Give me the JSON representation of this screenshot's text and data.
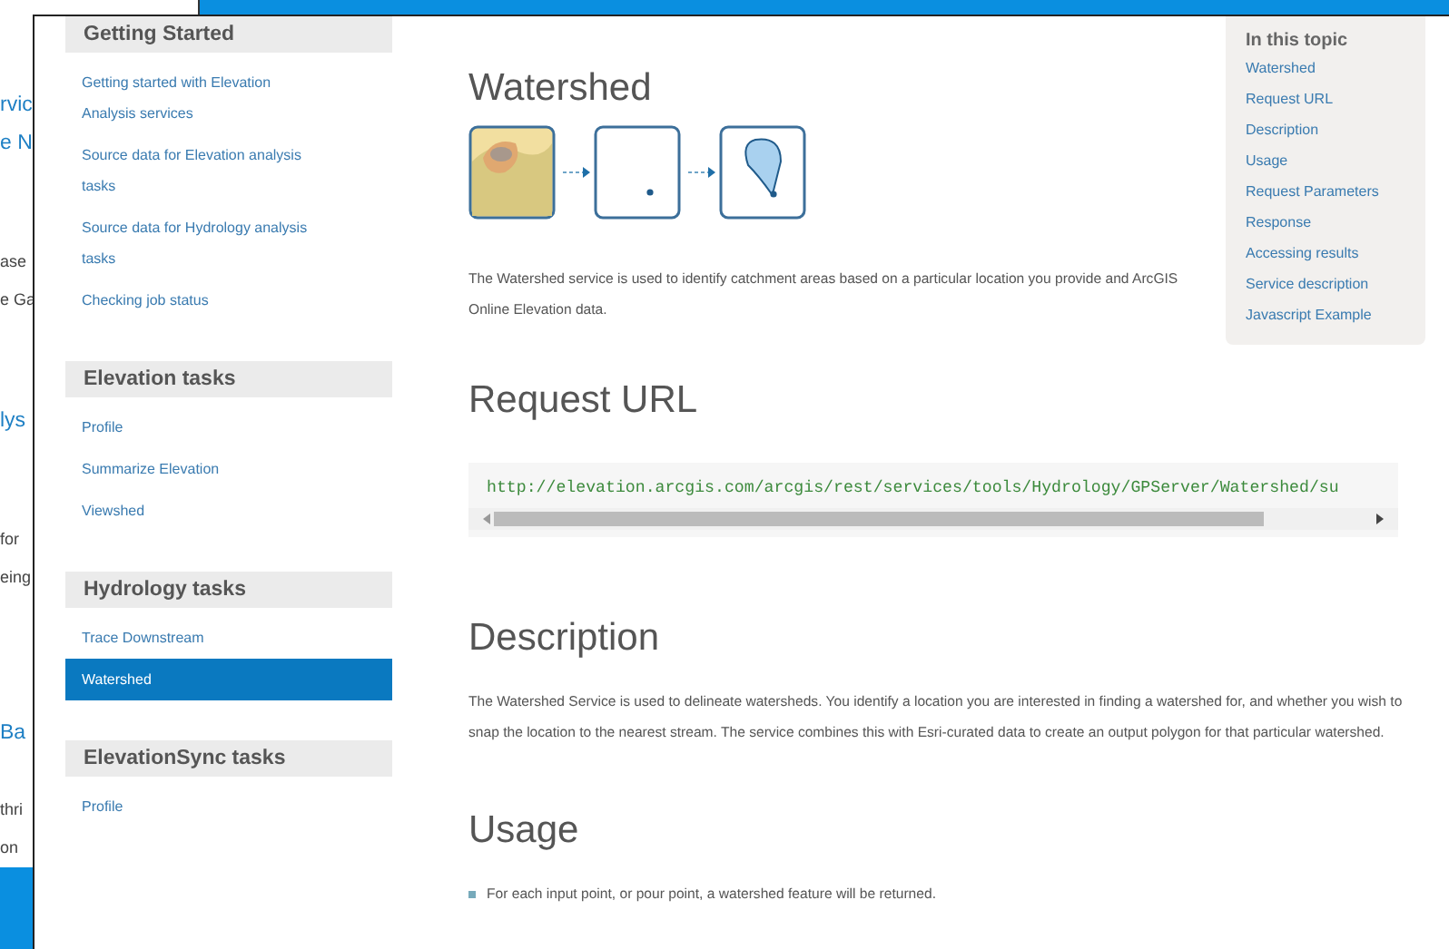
{
  "back_window": {
    "fragments": [
      {
        "kind": "heading",
        "text": "rvic"
      },
      {
        "kind": "heading",
        "text": "e N"
      },
      {
        "kind": "body",
        "text": "ase"
      },
      {
        "kind": "body",
        "text": "e Ga"
      },
      {
        "kind": "heading",
        "text": "lys"
      },
      {
        "kind": "body",
        "text": "for"
      },
      {
        "kind": "body",
        "text": "eing"
      },
      {
        "kind": "heading",
        "text": "Ba"
      },
      {
        "kind": "body",
        "text": "thri"
      },
      {
        "kind": "body",
        "text": "on"
      }
    ]
  },
  "sidebar": {
    "sections": [
      {
        "title": "Getting Started",
        "items": [
          {
            "label": "Getting started with Elevation Analysis services",
            "selected": false
          },
          {
            "label": "Source data for Elevation analysis tasks",
            "selected": false
          },
          {
            "label": "Source data for Hydrology analysis tasks",
            "selected": false
          },
          {
            "label": "Checking job status",
            "selected": false
          }
        ]
      },
      {
        "title": "Elevation tasks",
        "items": [
          {
            "label": "Profile",
            "selected": false
          },
          {
            "label": "Summarize Elevation",
            "selected": false
          },
          {
            "label": "Viewshed",
            "selected": false
          }
        ]
      },
      {
        "title": "Hydrology tasks",
        "items": [
          {
            "label": "Trace Downstream",
            "selected": false
          },
          {
            "label": "Watershed",
            "selected": true
          }
        ]
      },
      {
        "title": "ElevationSync tasks",
        "items": [
          {
            "label": "Profile",
            "selected": false
          }
        ]
      }
    ]
  },
  "content": {
    "title": "Watershed",
    "intro": "The Watershed service is used to identify catchment areas based on a particular location you provide and ArcGIS Online Elevation data.",
    "request_url": {
      "heading": "Request URL",
      "url": "http://elevation.arcgis.com/arcgis/rest/services/tools/Hydrology/GPServer/Watershed/su"
    },
    "description": {
      "heading": "Description",
      "text": "The Watershed Service is used to delineate watersheds. You identify a location you are interested in finding a watershed for, and whether you wish to snap the location to the nearest stream. The service combines this with Esri-curated data to create an output polygon for that particular watershed."
    },
    "usage": {
      "heading": "Usage",
      "bullets": [
        "For each input point, or pour point, a watershed feature will be returned."
      ]
    }
  },
  "toc": {
    "title": "In this topic",
    "links": [
      "Watershed",
      "Request URL",
      "Description",
      "Usage",
      "Request Parameters",
      "Response",
      "Accessing results",
      "Service description",
      "Javascript Example"
    ]
  }
}
